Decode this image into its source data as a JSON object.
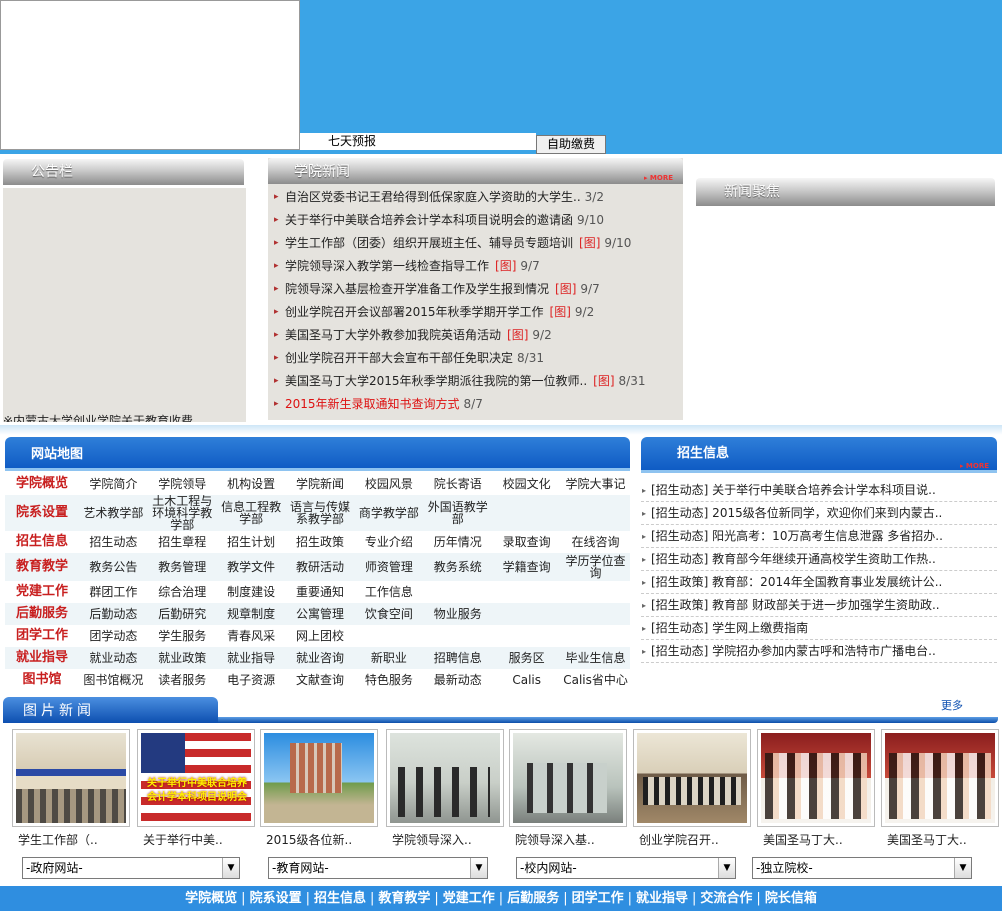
{
  "top": {
    "forecast_label": "七天预报",
    "pay_button": "自助缴费"
  },
  "notice": {
    "title": "公告栏",
    "marquee": "※内蒙古大学创业学院关于教育收费.."
  },
  "news": {
    "title": "学院新闻",
    "more": "MORE",
    "items": [
      {
        "title": "自治区党委书记王君给得到低保家庭入学资助的大学生..",
        "date": "3/2",
        "tu": ""
      },
      {
        "title": "关于举行中美联合培养会计学本科项目说明会的邀请函",
        "date": "9/10",
        "tu": ""
      },
      {
        "title": "学生工作部（团委）组织开展班主任、辅导员专题培训",
        "date": "9/10",
        "tu": "[图]"
      },
      {
        "title": "学院领导深入教学第一线检查指导工作",
        "date": "9/7",
        "tu": "[图]"
      },
      {
        "title": "院领导深入基层检查开学准备工作及学生报到情况",
        "date": "9/7",
        "tu": "[图]"
      },
      {
        "title": "创业学院召开会议部署2015年秋季学期开学工作",
        "date": "9/2",
        "tu": "[图]"
      },
      {
        "title": "美国圣马丁大学外教参加我院英语角活动",
        "date": "9/2",
        "tu": "[图]"
      },
      {
        "title": "创业学院召开干部大会宣布干部任免职决定",
        "date": "8/31",
        "tu": ""
      },
      {
        "title": "美国圣马丁大学2015年秋季学期派往我院的第一位教师..",
        "date": "8/31",
        "tu": "[图]"
      },
      {
        "title": "2015年新生录取通知书查询方式",
        "date": "8/7",
        "tu": ""
      }
    ]
  },
  "focus": {
    "title": "新闻聚焦"
  },
  "sitemap": {
    "title": "网站地图",
    "rows": [
      [
        "学院概览",
        "学院简介",
        "学院领导",
        "机构设置",
        "学院新闻",
        "校园风景",
        "院长寄语",
        "校园文化",
        "学院大事记"
      ],
      [
        "院系设置",
        "艺术教学部",
        "土木工程与环境科学教学部",
        "信息工程教学部",
        "语言与传媒系教学部",
        "商学教学部",
        "外国语教学部",
        "",
        ""
      ],
      [
        "招生信息",
        "招生动态",
        "招生章程",
        "招生计划",
        "招生政策",
        "专业介绍",
        "历年情况",
        "录取查询",
        "在线咨询"
      ],
      [
        "教育教学",
        "教务公告",
        "教务管理",
        "教学文件",
        "教研活动",
        "师资管理",
        "教务系统",
        "学籍查询",
        "学历学位查询"
      ],
      [
        "党建工作",
        "群团工作",
        "综合治理",
        "制度建设",
        "重要通知",
        "工作信息",
        "",
        "",
        ""
      ],
      [
        "后勤服务",
        "后勤动态",
        "后勤研究",
        "规章制度",
        "公寓管理",
        "饮食空间",
        "物业服务",
        "",
        ""
      ],
      [
        "团学工作",
        "团学动态",
        "学生服务",
        "青春风采",
        "网上团校",
        "",
        "",
        "",
        ""
      ],
      [
        "就业指导",
        "就业动态",
        "就业政策",
        "就业指导",
        "就业咨询",
        "新职业",
        "招聘信息",
        "服务区",
        "毕业生信息"
      ],
      [
        "图书馆",
        "图书馆概况",
        "读者服务",
        "电子资源",
        "文献查询",
        "特色服务",
        "最新动态",
        "Calis",
        "Calis省中心"
      ]
    ]
  },
  "admit": {
    "title": "招生信息",
    "more": "MORE",
    "items": [
      "[招生动态] 关于举行中美联合培养会计学本科项目说..",
      "[招生动态] 2015级各位新同学，欢迎你们来到内蒙古..",
      "[招生动态] 阳光高考：10万高考生信息泄露 多省招办..",
      "[招生动态] 教育部今年继续开通高校学生资助工作热..",
      "[招生政策] 教育部：2014年全国教育事业发展统计公..",
      "[招生政策] 教育部 财政部关于进一步加强学生资助政..",
      "[招生动态] 学生网上缴费指南",
      "[招生动态] 学院招办参加内蒙古呼和浩特市广播电台.."
    ]
  },
  "pictures": {
    "title": "图片新闻",
    "more": "更多",
    "items": [
      {
        "caption": "学生工作部（..",
        "kind": "classroom"
      },
      {
        "caption": "关于举行中美..",
        "kind": "flag",
        "overlay": "关于举行中美联合培养会计学本科项目说明会"
      },
      {
        "caption": "2015级各位新..",
        "kind": "building"
      },
      {
        "caption": "学院领导深入..",
        "kind": "hall"
      },
      {
        "caption": "院领导深入基..",
        "kind": "gate"
      },
      {
        "caption": "创业学院召开..",
        "kind": "meeting"
      },
      {
        "caption": "美国圣马丁大..",
        "kind": "girls"
      },
      {
        "caption": "美国圣马丁大..",
        "kind": "girls"
      }
    ]
  },
  "links": {
    "selects": [
      "-政府网站-",
      "-教育网站-",
      "-校内网站-",
      "-独立院校-"
    ]
  },
  "footer": {
    "items": [
      "学院概览",
      "院系设置",
      "招生信息",
      "教育教学",
      "党建工作",
      "后勤服务",
      "团学工作",
      "就业指导",
      "交流合作",
      "院长信箱"
    ]
  }
}
